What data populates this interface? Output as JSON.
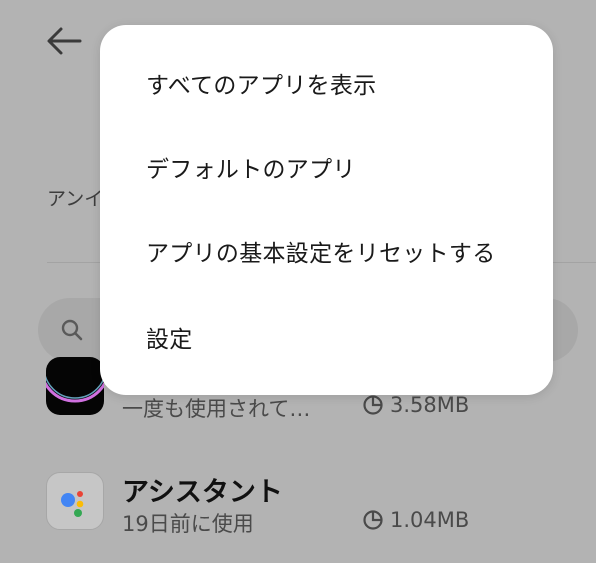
{
  "background": {
    "filter_text": "アンイ",
    "search_icon": "search-icon",
    "apps": [
      {
        "name": "",
        "subtitle": "一度も使用されて…",
        "size": "3.58MB",
        "icon": "dark-app-icon"
      },
      {
        "name": "アシスタント",
        "subtitle": "19日前に使用",
        "size": "1.04MB",
        "icon": "google-assistant-icon"
      }
    ]
  },
  "menu": {
    "items": [
      {
        "label": "すべてのアプリを表示"
      },
      {
        "label": "デフォルトのアプリ"
      },
      {
        "label": "アプリの基本設定をリセットする"
      },
      {
        "label": "設定"
      }
    ]
  },
  "colors": {
    "scrim_background": "#b3b3b3",
    "menu_background": "#ffffff",
    "text_primary": "#1a1a1a",
    "assistant_blue": "#4285F4",
    "assistant_red": "#EA4335",
    "assistant_yellow": "#FBBC05",
    "assistant_green": "#34A853"
  }
}
